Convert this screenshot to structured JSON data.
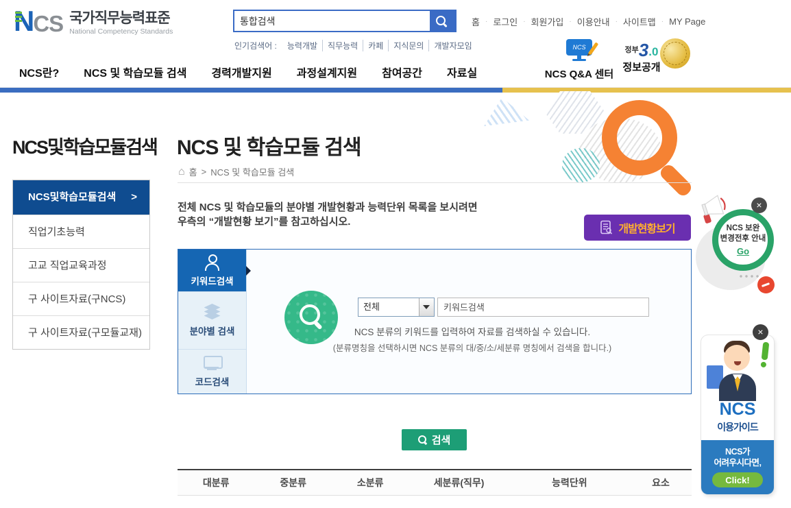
{
  "header": {
    "logo": {
      "n": "N",
      "cs": "CS",
      "korean": "국가직무능력표준",
      "english": "National Competency Standards"
    },
    "search": {
      "value": "통합검색"
    },
    "popular": {
      "label": "인기검색어 :",
      "terms": [
        "능력개발",
        "직무능력",
        "카페",
        "지식문의",
        "개발자모임"
      ]
    },
    "utility_links": [
      "홈",
      "로그인",
      "회원가입",
      "이용안내",
      "사이트맵",
      "MY Page"
    ],
    "nav_items": [
      "NCS란?",
      "NCS 및 학습모듈 검색",
      "경력개발지원",
      "과정설계지원",
      "참여공간",
      "자료실"
    ],
    "qna_label": "NCS Q&A 센터",
    "qna_icon_text": "NCS",
    "info_label": "정보공개",
    "gov30_prefix": "정부",
    "gov30_number": "3",
    "gov30_suffix": ".0"
  },
  "sidebar": {
    "title": "NCS및학습모듈검색",
    "items": [
      {
        "label": "NCS및학습모듈검색",
        "chevron": ">"
      },
      {
        "label": "직업기초능력"
      },
      {
        "label": "고교 직업교육과정"
      },
      {
        "label": "구 사이트자료(구NCS)"
      },
      {
        "label": "구 사이트자료(구모듈교재)"
      }
    ]
  },
  "main": {
    "title": "NCS 및 학습모듈 검색",
    "breadcrumb": {
      "home_icon": "⌂",
      "home": "홈",
      "separator": ">",
      "current": "NCS 및 학습모듈 검색"
    },
    "description_line1": "전체 NCS 및 학습모듈의 분야별 개발현황과 능력단위 목록을 보시려면",
    "description_line2": "우측의 “개발현황 보기”를 참고하십시오.",
    "dev_status_button": "개발현황보기",
    "tabs": [
      {
        "label": "키워드검색"
      },
      {
        "label": "분야별 검색"
      },
      {
        "label": "코드검색"
      }
    ],
    "form": {
      "select_value": "전체",
      "input_placeholder": "키워드검색",
      "help_line1": "NCS 분류의 키워드를 입력하여 자료를 검색하실 수 있습니다.",
      "help_line2": "(분류명칭을 선택하시면 NCS 분류의 대/중/소/세분류 명칭에서 검색을 합니다.)"
    },
    "search_button": "검색",
    "table_headers": [
      "대분류",
      "중분류",
      "소분류",
      "세분류(직무)",
      "능력단위",
      "요소"
    ]
  },
  "popups": {
    "notice": {
      "line1": "NCS 보완",
      "line2": "변경전후 안내",
      "go": "Go",
      "close": "×"
    },
    "guide": {
      "ncs": "NCS",
      "title": "이용가이드",
      "footer_line1": "NCS가",
      "footer_line2": "어려우시다면,",
      "click": "Click!",
      "close": "×"
    }
  },
  "colors": {
    "primary_blue": "#2b6cb8",
    "nav_bar_blue": "#3b6dc0",
    "nav_bar_gold": "#e6c14e",
    "sidebar_active": "#0f4c90",
    "tab_active": "#1566b3",
    "icon_green": "#35b989",
    "search_green": "#1d9e76",
    "purple": "#6a2fb0",
    "purple_text": "#ffaf2e",
    "orange_mag": "#f58233",
    "notice_green": "#2aa368",
    "guide_blue": "#2b7bbf",
    "click_green": "#76b93e"
  }
}
